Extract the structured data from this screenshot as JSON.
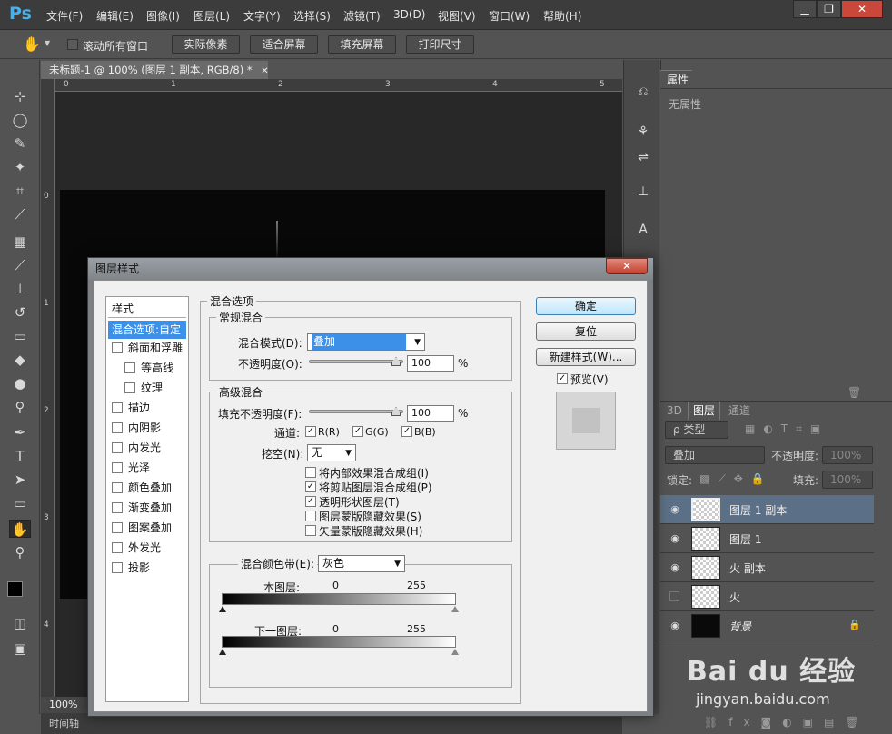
{
  "app": {
    "logo": "Ps"
  },
  "menu": [
    "文件(F)",
    "编辑(E)",
    "图像(I)",
    "图层(L)",
    "文字(Y)",
    "选择(S)",
    "滤镜(T)",
    "3D(D)",
    "视图(V)",
    "窗口(W)",
    "帮助(H)"
  ],
  "window_controls": {
    "minimize": "▁",
    "restore": "❐",
    "close": "✕"
  },
  "options_bar": {
    "scroll_all": "滚动所有窗口",
    "btn1": "实际像素",
    "btn2": "适合屏幕",
    "btn3": "填充屏幕",
    "btn4": "打印尺寸"
  },
  "document": {
    "tab_title": "未标题-1 @ 100% (图层 1 副本, RGB/8) *",
    "tab_close": "✕",
    "ruler_h": [
      "0",
      "1",
      "2",
      "3",
      "4",
      "5"
    ],
    "ruler_v": [
      "0",
      "1",
      "2",
      "3",
      "4"
    ],
    "zoom": "100%",
    "timeline_label": "时间轴"
  },
  "properties": {
    "tab": "属性",
    "empty": "无属性"
  },
  "layers_panel": {
    "tabs": [
      "3D",
      "图层",
      "通道"
    ],
    "filter_label": "ρ 类型",
    "blend_mode": "叠加",
    "opacity_label": "不透明度:",
    "opacity_value": "100%",
    "lock_label": "锁定:",
    "fill_label": "填充:",
    "fill_value": "100%",
    "layers": [
      {
        "name": "图层 1 副本",
        "visible": true,
        "selected": true,
        "type": "transparent"
      },
      {
        "name": "图层 1",
        "visible": true,
        "selected": false,
        "type": "transparent"
      },
      {
        "name": "火 副本",
        "visible": true,
        "selected": false,
        "type": "transparent"
      },
      {
        "name": "火",
        "visible": false,
        "selected": false,
        "type": "transparent"
      },
      {
        "name": "背景",
        "visible": true,
        "selected": false,
        "type": "black",
        "locked": true
      }
    ]
  },
  "watermark": {
    "brand": "Bai du 经验",
    "url": "jingyan.baidu.com"
  },
  "dialog": {
    "title": "图层样式",
    "close": "✕",
    "styles_header": "样式",
    "styles": [
      {
        "label": "混合选项:自定",
        "selected": true,
        "checkbox": false
      },
      {
        "label": "斜面和浮雕",
        "checkbox": true,
        "checked": false
      },
      {
        "label": "等高线",
        "checkbox": true,
        "checked": false,
        "indent": true
      },
      {
        "label": "纹理",
        "checkbox": true,
        "checked": false,
        "indent": true
      },
      {
        "label": "描边",
        "checkbox": true,
        "checked": false
      },
      {
        "label": "内阴影",
        "checkbox": true,
        "checked": false
      },
      {
        "label": "内发光",
        "checkbox": true,
        "checked": false
      },
      {
        "label": "光泽",
        "checkbox": true,
        "checked": false
      },
      {
        "label": "颜色叠加",
        "checkbox": true,
        "checked": false
      },
      {
        "label": "渐变叠加",
        "checkbox": true,
        "checked": false
      },
      {
        "label": "图案叠加",
        "checkbox": true,
        "checked": false
      },
      {
        "label": "外发光",
        "checkbox": true,
        "checked": false
      },
      {
        "label": "投影",
        "checkbox": true,
        "checked": false
      }
    ],
    "blend_options": {
      "title": "混合选项",
      "general": {
        "title": "常规混合",
        "mode_label": "混合模式(D):",
        "mode_value": "叠加",
        "opacity_label": "不透明度(O):",
        "opacity_value": "100",
        "percent": "%"
      },
      "advanced": {
        "title": "高级混合",
        "fill_label": "填充不透明度(F):",
        "fill_value": "100",
        "percent": "%",
        "channels_label": "通道:",
        "ch_r": "R(R)",
        "ch_g": "G(G)",
        "ch_b": "B(B)",
        "knockout_label": "挖空(N):",
        "knockout_value": "无",
        "options": [
          {
            "label": "将内部效果混合成组(I)",
            "checked": false
          },
          {
            "label": "将剪贴图层混合成组(P)",
            "checked": true
          },
          {
            "label": "透明形状图层(T)",
            "checked": true
          },
          {
            "label": "图层蒙版隐藏效果(S)",
            "checked": false
          },
          {
            "label": "矢量蒙版隐藏效果(H)",
            "checked": false
          }
        ]
      },
      "blend_if": {
        "label": "混合颜色带(E):",
        "value": "灰色",
        "this_layer": "本图层:",
        "underlying": "下一图层:",
        "min": "0",
        "max": "255"
      }
    },
    "buttons": {
      "ok": "确定",
      "reset": "复位",
      "new_style": "新建样式(W)...",
      "preview": "预览(V)"
    }
  }
}
